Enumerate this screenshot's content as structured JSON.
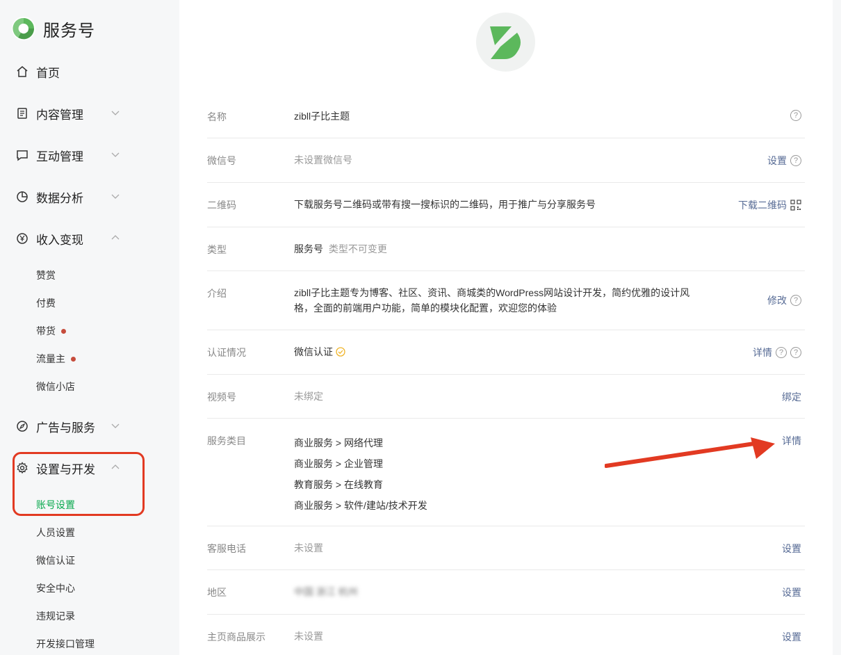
{
  "brand": {
    "name": "服务号"
  },
  "nav": [
    {
      "label": "首页",
      "icon": "home-icon"
    },
    {
      "label": "内容管理",
      "icon": "document-icon"
    },
    {
      "label": "互动管理",
      "icon": "chat-icon"
    },
    {
      "label": "数据分析",
      "icon": "pie-chart-icon"
    },
    {
      "label": "收入变现",
      "icon": "yen-icon"
    },
    {
      "label": "广告与服务",
      "icon": "compass-icon"
    },
    {
      "label": "设置与开发",
      "icon": "gear-icon"
    }
  ],
  "monetize_sub": [
    "赞赏",
    "付费",
    "带货",
    "流量主",
    "微信小店"
  ],
  "settings_sub": [
    "账号设置",
    "人员设置",
    "微信认证",
    "安全中心",
    "违规记录",
    "开发接口管理"
  ],
  "rows": {
    "name": {
      "label": "名称",
      "value": "zibll子比主题"
    },
    "wechat_id": {
      "label": "微信号",
      "value": "未设置微信号",
      "action": "设置"
    },
    "qrcode": {
      "label": "二维码",
      "value": "下载服务号二维码或带有搜一搜标识的二维码，用于推广与分享服务号",
      "action": "下载二维码"
    },
    "type": {
      "label": "类型",
      "value": "服务号",
      "note": "类型不可变更"
    },
    "intro": {
      "label": "介绍",
      "line1": "zibll子比主题专为博客、社区、资讯、商城类的WordPress网站设计开发，简约优雅的设计风",
      "line2": "格，全面的前端用户功能，简单的模块化配置，欢迎您的体验",
      "action": "修改"
    },
    "verify": {
      "label": "认证情况",
      "value": "微信认证",
      "action": "详情"
    },
    "channels": {
      "label": "视频号",
      "value": "未绑定",
      "action": "绑定"
    },
    "categories": {
      "label": "服务类目",
      "items": [
        "商业服务 > 网络代理",
        "商业服务 > 企业管理",
        "教育服务 > 在线教育",
        "商业服务 > 软件/建站/技术开发"
      ],
      "action": "详情"
    },
    "phone": {
      "label": "客服电话",
      "value": "未设置",
      "action": "设置"
    },
    "region": {
      "label": "地区",
      "value": "中国 浙江 杭州",
      "action": "设置"
    },
    "shop": {
      "label": "主页商品展示",
      "value": "未设置",
      "action": "设置"
    }
  },
  "colors": {
    "accent_green": "#07a84c",
    "link_blue": "#576b95",
    "highlight_red": "#e23a22",
    "dot_red": "#c64c3c"
  }
}
